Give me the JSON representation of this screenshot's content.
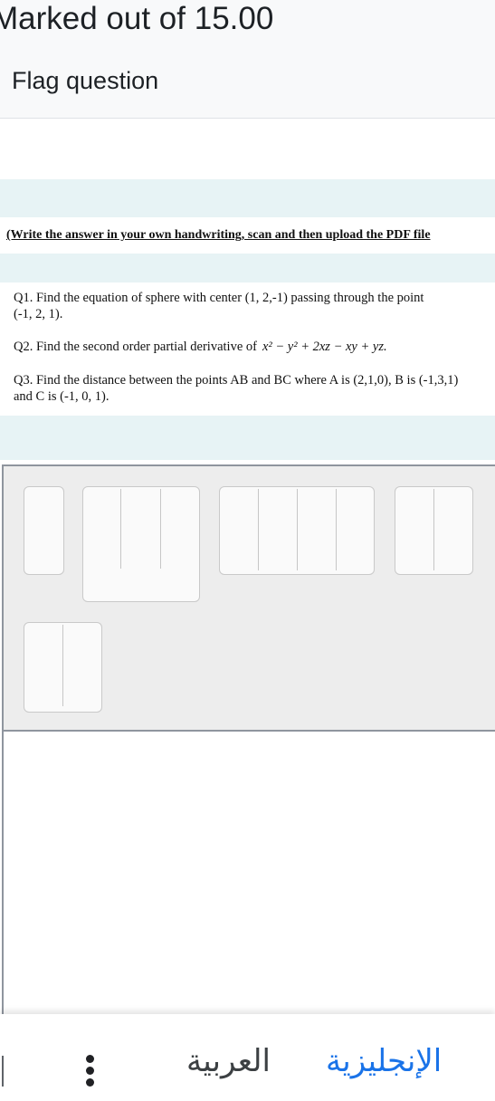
{
  "info": {
    "marked": "Marked out of 15.00",
    "flag": "Flag question"
  },
  "question": {
    "instruction": "(Write the answer in your own handwriting, scan and then upload the PDF file",
    "q1": "Q1. Find the equation of sphere with center (1, 2,-1) passing through the point",
    "q1_cont": "(-1, 2, 1).",
    "q2": "Q2. Find the second order partial derivative of",
    "q2_math": "x² − y² + 2xz − xy + yz.",
    "q3": "Q3. Find the distance between the points AB and BC where A is (2,1,0), B is (-1,3,1)",
    "q3_cont": "and C is  (-1, 0, 1)."
  },
  "bottom_bar": {
    "english": "الإنجليزية",
    "arabic": "العربية",
    "more_icon": "more-vert-icon"
  },
  "colors": {
    "question_bg": "#e7f3f5",
    "upload_bg": "#ededed",
    "link": "#1a73e8"
  }
}
